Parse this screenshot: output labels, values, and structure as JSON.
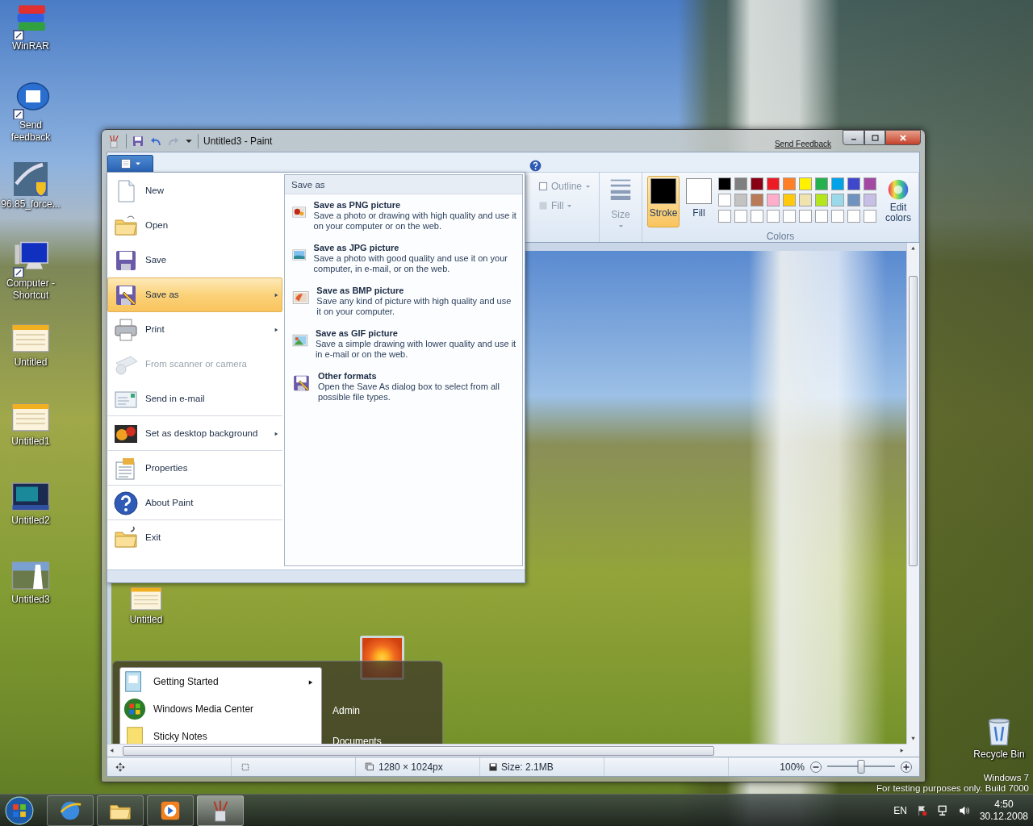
{
  "desktop": {
    "icons": [
      {
        "label": "WinRAR"
      },
      {
        "label": "Send feedback"
      },
      {
        "label": "96.85_force..."
      },
      {
        "label": "Computer - Shortcut"
      },
      {
        "label": "Untitled"
      },
      {
        "label": "Untitled1"
      },
      {
        "label": "Untitled2"
      },
      {
        "label": "Untitled3"
      }
    ],
    "recycle_bin": {
      "label": "Recycle Bin"
    },
    "watermark_lines": [
      "Windows 7",
      "For testing purposes only. Build 7000"
    ]
  },
  "window": {
    "title": "Untitled3 - Paint",
    "feedback_link": "Send Feedback"
  },
  "file_menu": {
    "items": [
      {
        "label": "New",
        "submenu": false,
        "disabled": false,
        "selected": false,
        "divider_after": false
      },
      {
        "label": "Open",
        "submenu": false,
        "disabled": false,
        "selected": false,
        "divider_after": false
      },
      {
        "label": "Save",
        "submenu": false,
        "disabled": false,
        "selected": false,
        "divider_after": false
      },
      {
        "label": "Save as",
        "submenu": true,
        "disabled": false,
        "selected": true,
        "divider_after": false
      },
      {
        "label": "Print",
        "submenu": true,
        "disabled": false,
        "selected": false,
        "divider_after": false
      },
      {
        "label": "From scanner or camera",
        "submenu": false,
        "disabled": true,
        "selected": false,
        "divider_after": false
      },
      {
        "label": "Send in e-mail",
        "submenu": false,
        "disabled": false,
        "selected": false,
        "divider_after": true
      },
      {
        "label": "Set as desktop background",
        "submenu": true,
        "disabled": false,
        "selected": false,
        "divider_after": true
      },
      {
        "label": "Properties",
        "submenu": false,
        "disabled": false,
        "selected": false,
        "divider_after": true
      },
      {
        "label": "About Paint",
        "submenu": false,
        "disabled": false,
        "selected": false,
        "divider_after": true
      },
      {
        "label": "Exit",
        "submenu": false,
        "disabled": false,
        "selected": false,
        "divider_after": false
      }
    ]
  },
  "save_as_panel": {
    "title": "Save as",
    "options": [
      {
        "title": "Save as PNG picture",
        "description": "Save a photo or drawing with high quality and use it on your computer or on the web."
      },
      {
        "title": "Save as JPG picture",
        "description": "Save a photo with good quality and use it on your computer, in e-mail, or on the web."
      },
      {
        "title": "Save as BMP picture",
        "description": "Save any kind of picture with high quality and use it on your computer."
      },
      {
        "title": "Save as GIF picture",
        "description": "Save a simple drawing with lower quality and use it in e-mail or on the web."
      },
      {
        "title": "Other formats",
        "description": "Open the Save As dialog box to select from all possible file types."
      }
    ]
  },
  "ribbon": {
    "outline": {
      "label": "Outline",
      "disabled": true
    },
    "fill_style": {
      "label": "Fill",
      "disabled": true
    },
    "size": {
      "label": "Size",
      "disabled": true
    },
    "stroke": {
      "label": "Stroke",
      "selected": true,
      "color": "#000000"
    },
    "fill": {
      "label": "Fill",
      "selected": false,
      "color": "#ffffff"
    },
    "palette": [
      [
        {
          "color": "#000000"
        },
        {
          "color": "#7f7f7f"
        },
        {
          "color": "#880015"
        },
        {
          "color": "#ed1c24"
        },
        {
          "color": "#ff7f27"
        },
        {
          "color": "#fff200"
        },
        {
          "color": "#22b14c"
        },
        {
          "color": "#00a2e8"
        },
        {
          "color": "#3f48cc"
        },
        {
          "color": "#a349a4"
        }
      ],
      [
        {
          "color": "#ffffff"
        },
        {
          "color": "#c3c3c3"
        },
        {
          "color": "#b97a57"
        },
        {
          "color": "#ffaec9"
        },
        {
          "color": "#ffc90e"
        },
        {
          "color": "#efe4b0"
        },
        {
          "color": "#b5e61d"
        },
        {
          "color": "#99d9ea"
        },
        {
          "color": "#7092be"
        },
        {
          "color": "#c8bfe7"
        }
      ],
      [
        {
          "color": "#ffffff"
        },
        {
          "color": "#ffffff"
        },
        {
          "color": "#ffffff"
        },
        {
          "color": "#ffffff"
        },
        {
          "color": "#ffffff"
        },
        {
          "color": "#ffffff"
        },
        {
          "color": "#ffffff"
        },
        {
          "color": "#ffffff"
        },
        {
          "color": "#ffffff"
        },
        {
          "color": "#ffffff"
        }
      ]
    ],
    "edit_colors": "Edit colors",
    "group_label": "Colors"
  },
  "canvas": {
    "desktop_icon": {
      "label": "Untitled"
    },
    "start_menu": {
      "programs": [
        {
          "label": "Getting Started",
          "submenu": true
        },
        {
          "label": "Windows Media Center",
          "submenu": false
        },
        {
          "label": "Sticky Notes",
          "submenu": false
        }
      ],
      "places": [
        "Admin",
        "Documents"
      ]
    }
  },
  "status_bar": {
    "dimensions": "1280 × 1024px",
    "size": "Size: 2.1MB",
    "zoom": "100%",
    "zoom_slider": {
      "level": 0.5
    }
  },
  "taskbar": {
    "buttons": [
      {
        "selected": false
      },
      {
        "selected": false
      },
      {
        "selected": false
      },
      {
        "selected": true
      }
    ],
    "language": "EN",
    "time": "4:50",
    "date": "30.12.2008"
  }
}
